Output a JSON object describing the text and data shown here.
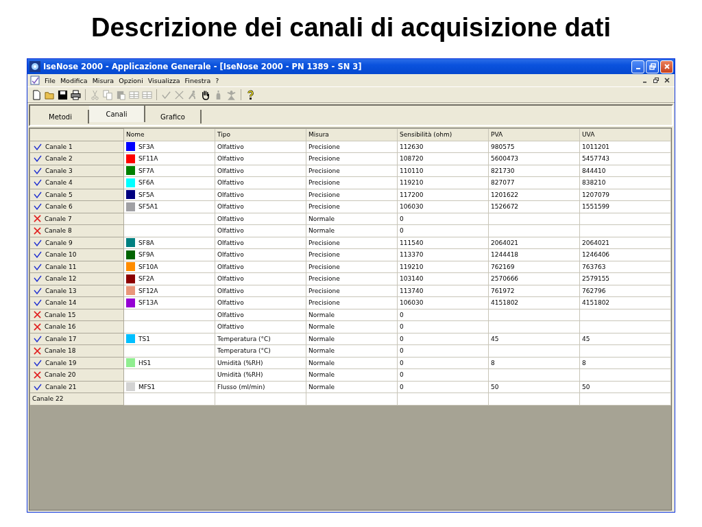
{
  "slide_title": "Descrizione dei canali di acquisizione dati",
  "window": {
    "title": "IseNose 2000 - Applicazione Generale - [IseNose 2000 - PN 1389 - SN 3]"
  },
  "menu": [
    "File",
    "Modifica",
    "Misura",
    "Opzioni",
    "Visualizza",
    "Finestra",
    "?"
  ],
  "toolbar": [
    {
      "kind": "new",
      "disabled": false
    },
    {
      "kind": "open",
      "disabled": false
    },
    {
      "kind": "save",
      "disabled": false
    },
    {
      "kind": "print",
      "disabled": false
    },
    {
      "kind": "separator"
    },
    {
      "kind": "cut",
      "disabled": true
    },
    {
      "kind": "copy",
      "disabled": true
    },
    {
      "kind": "paste",
      "disabled": true
    },
    {
      "kind": "grid",
      "disabled": true
    },
    {
      "kind": "grid",
      "disabled": true
    },
    {
      "kind": "separator"
    },
    {
      "kind": "check",
      "disabled": true
    },
    {
      "kind": "cross",
      "disabled": true
    },
    {
      "kind": "runner",
      "disabled": true
    },
    {
      "kind": "hand",
      "disabled": false
    },
    {
      "kind": "bottle",
      "disabled": true
    },
    {
      "kind": "figure",
      "disabled": true
    },
    {
      "kind": "separator"
    },
    {
      "kind": "help",
      "disabled": false
    }
  ],
  "tabs": [
    {
      "label": "Metodi",
      "selected": false
    },
    {
      "label": "Canali",
      "selected": true
    },
    {
      "label": "Grafico",
      "selected": false
    }
  ],
  "table": {
    "columns": [
      "Nome",
      "Tipo",
      "Misura",
      "Sensibilità (ohm)",
      "PVA",
      "UVA"
    ],
    "rows": [
      {
        "label": "Canale 1",
        "kind": "active",
        "color": "#0000ff",
        "cells": [
          "SF3A",
          "Olfattivo",
          "Precisione",
          "112630",
          "980575",
          "1011201"
        ]
      },
      {
        "label": "Canale 2",
        "kind": "active",
        "color": "#ff0000",
        "cells": [
          "SF11A",
          "Olfattivo",
          "Precisione",
          "108720",
          "5600473",
          "5457743"
        ]
      },
      {
        "label": "Canale 3",
        "kind": "active",
        "color": "#008000",
        "cells": [
          "SF7A",
          "Olfattivo",
          "Precisione",
          "110110",
          "821730",
          "844410"
        ]
      },
      {
        "label": "Canale 4",
        "kind": "active",
        "color": "#00ffff",
        "cells": [
          "SF6A",
          "Olfattivo",
          "Precisione",
          "119210",
          "827077",
          "838210"
        ]
      },
      {
        "label": "Canale 5",
        "kind": "active",
        "color": "#000080",
        "cells": [
          "SF5A",
          "Olfattivo",
          "Precisione",
          "117200",
          "1201622",
          "1207079"
        ]
      },
      {
        "label": "Canale 6",
        "kind": "active",
        "color": "#a0a0a4",
        "cells": [
          "SF5A1",
          "Olfattivo",
          "Precisione",
          "106030",
          "1526672",
          "1551599"
        ]
      },
      {
        "label": "Canale 7",
        "kind": "inactive",
        "cells": [
          "",
          "Olfattivo",
          "Normale",
          "0",
          "",
          ""
        ]
      },
      {
        "label": "Canale 8",
        "kind": "inactive",
        "cells": [
          "",
          "Olfattivo",
          "Normale",
          "0",
          "",
          ""
        ]
      },
      {
        "label": "Canale 9",
        "kind": "active",
        "color": "#008080",
        "cells": [
          "SF8A",
          "Olfattivo",
          "Precisione",
          "111540",
          "2064021",
          "2064021"
        ]
      },
      {
        "label": "Canale 10",
        "kind": "active",
        "color": "#006400",
        "cells": [
          "SF9A",
          "Olfattivo",
          "Precisione",
          "113370",
          "1244418",
          "1246406"
        ]
      },
      {
        "label": "Canale 11",
        "kind": "active",
        "color": "#ff8c00",
        "cells": [
          "SF10A",
          "Olfattivo",
          "Precisione",
          "119210",
          "762169",
          "763763"
        ]
      },
      {
        "label": "Canale 12",
        "kind": "active",
        "color": "#8b0000",
        "cells": [
          "SF2A",
          "Olfattivo",
          "Precisione",
          "103140",
          "2570666",
          "2579155"
        ]
      },
      {
        "label": "Canale 13",
        "kind": "active",
        "color": "#e9967a",
        "cells": [
          "SF12A",
          "Olfattivo",
          "Precisione",
          "113740",
          "761972",
          "762796"
        ]
      },
      {
        "label": "Canale 14",
        "kind": "active",
        "color": "#9400d3",
        "cells": [
          "SF13A",
          "Olfattivo",
          "Precisione",
          "106030",
          "4151802",
          "4151802"
        ]
      },
      {
        "label": "Canale 15",
        "kind": "inactive",
        "cells": [
          "",
          "Olfattivo",
          "Normale",
          "0",
          "",
          ""
        ]
      },
      {
        "label": "Canale 16",
        "kind": "inactive",
        "cells": [
          "",
          "Olfattivo",
          "Normale",
          "0",
          "",
          ""
        ]
      },
      {
        "label": "Canale 17",
        "kind": "active",
        "color": "#00bfff",
        "cells": [
          "TS1",
          "Temperatura (°C)",
          "Normale",
          "0",
          "45",
          "45"
        ]
      },
      {
        "label": "Canale 18",
        "kind": "inactive",
        "cells": [
          "",
          "Temperatura (°C)",
          "Normale",
          "0",
          "",
          ""
        ]
      },
      {
        "label": "Canale 19",
        "kind": "active",
        "color": "#90ee90",
        "cells": [
          "HS1",
          "Umidità (%RH)",
          "Normale",
          "0",
          "8",
          "8"
        ]
      },
      {
        "label": "Canale 20",
        "kind": "inactive",
        "cells": [
          "",
          "Umidità (%RH)",
          "Normale",
          "0",
          "",
          ""
        ]
      },
      {
        "label": "Canale 21",
        "kind": "active",
        "color": "#d3d3d3",
        "cells": [
          "MFS1",
          "Flusso (ml/min)",
          "Normale",
          "0",
          "50",
          "50"
        ]
      },
      {
        "label": "Canale 22",
        "kind": "blank",
        "cells": [
          "",
          "",
          "",
          "",
          "",
          ""
        ]
      }
    ]
  }
}
